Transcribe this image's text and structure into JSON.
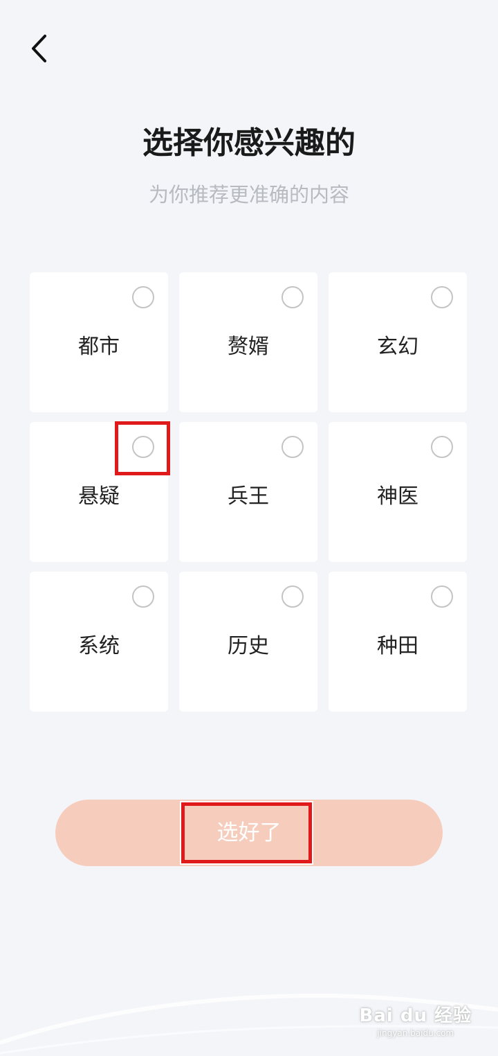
{
  "header": {
    "back_icon": "chevron-left-icon"
  },
  "intro": {
    "title": "选择你感兴趣的",
    "subtitle": "为你推荐更准确的内容"
  },
  "genres": [
    {
      "label": "都市",
      "selected": false
    },
    {
      "label": "赘婿",
      "selected": false
    },
    {
      "label": "玄幻",
      "selected": false
    },
    {
      "label": "悬疑",
      "selected": false
    },
    {
      "label": "兵王",
      "selected": false
    },
    {
      "label": "神医",
      "selected": false
    },
    {
      "label": "系统",
      "selected": false
    },
    {
      "label": "历史",
      "selected": false
    },
    {
      "label": "种田",
      "selected": false
    }
  ],
  "footer": {
    "confirm_label": "选好了"
  },
  "annotations": {
    "highlight_color": "#e01a1a"
  },
  "watermark": {
    "main": "Bai du 经验",
    "sub": "jingyan.baidu.com"
  },
  "colors": {
    "background": "#f3f5f9",
    "button_disabled": "#f6cdbd",
    "subtitle": "#b7bac0"
  }
}
